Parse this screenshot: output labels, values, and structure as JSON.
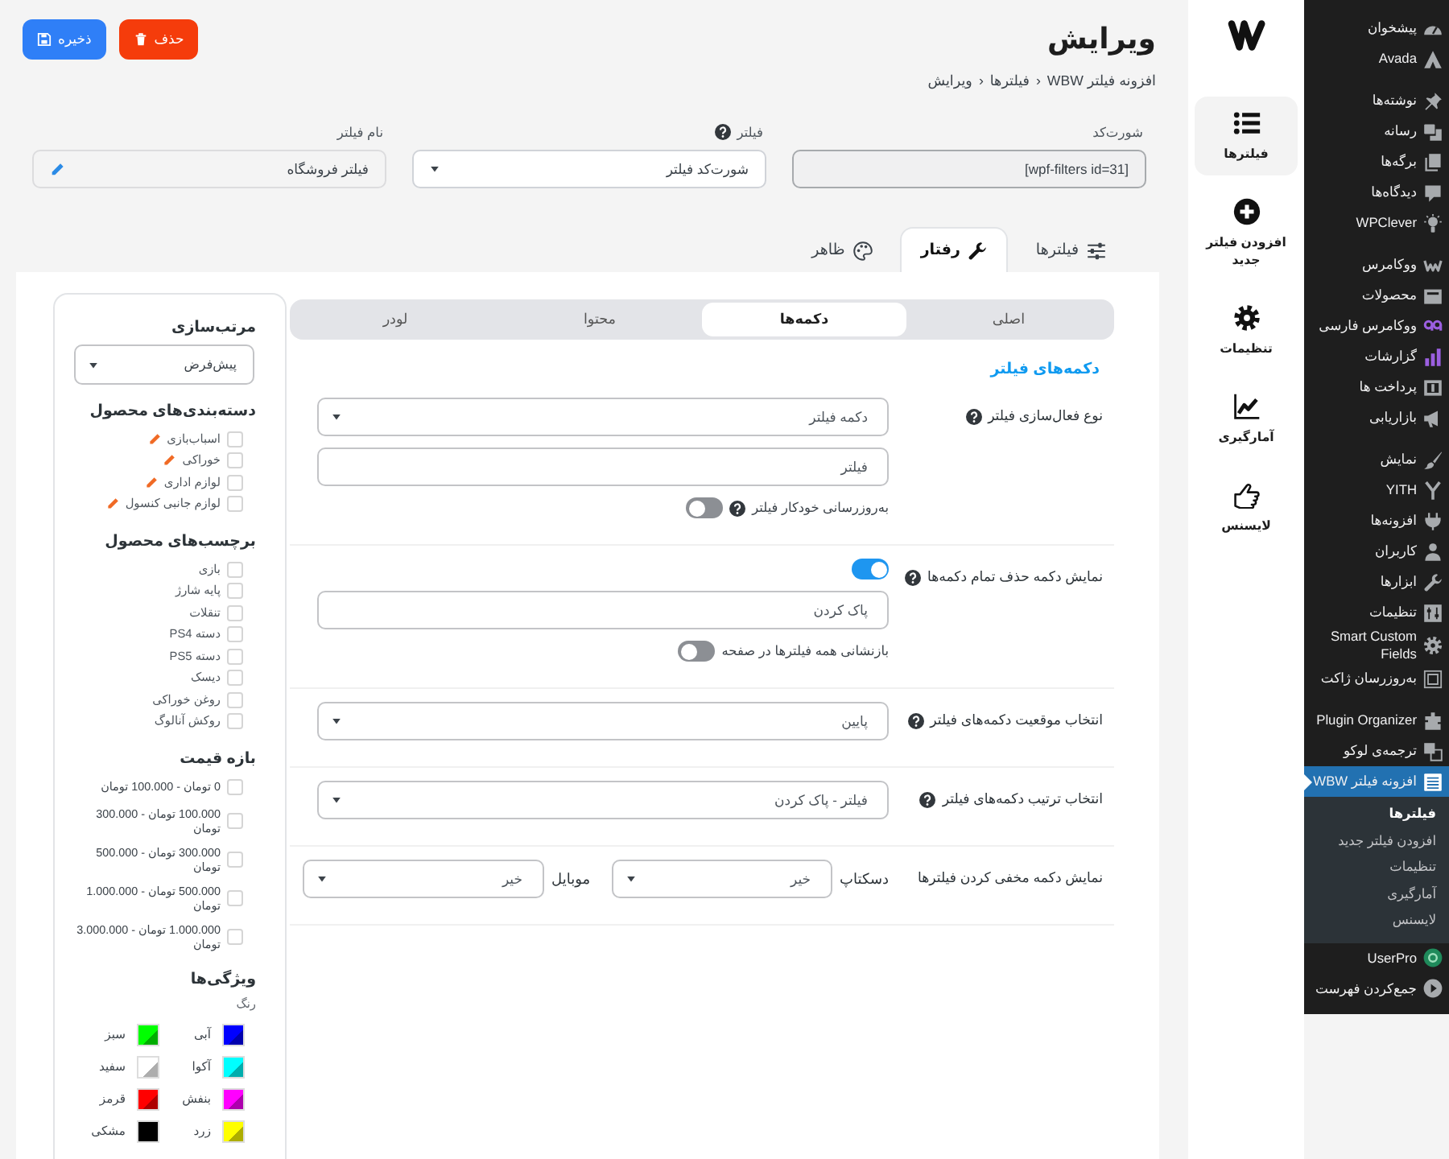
{
  "admin_menu": {
    "groups": [
      {
        "items": [
          {
            "label": "پیشخوان",
            "selected": false
          },
          {
            "label": "Avada",
            "selected": false
          }
        ]
      },
      {
        "items": [
          {
            "label": "نوشته‌ها",
            "selected": false
          },
          {
            "label": "رسانه",
            "selected": false
          },
          {
            "label": "برگه‌ها",
            "selected": false
          },
          {
            "label": "دیدگاه‌ها",
            "selected": false
          },
          {
            "label": "WPClever",
            "selected": false
          }
        ]
      },
      {
        "items": [
          {
            "label": "ووکامرس",
            "selected": false
          },
          {
            "label": "محصولات",
            "selected": false
          },
          {
            "label": "ووکامرس فارسی",
            "selected": false
          },
          {
            "label": "گزارشات",
            "selected": false
          },
          {
            "label": "پرداخت ها",
            "selected": false
          },
          {
            "label": "بازاریابی",
            "selected": false
          }
        ]
      },
      {
        "items": [
          {
            "label": "نمایش",
            "selected": false
          },
          {
            "label": "YITH",
            "selected": false
          },
          {
            "label": "افزونه‌ها",
            "selected": false
          },
          {
            "label": "کاربران",
            "selected": false
          },
          {
            "label": "ابزارها",
            "selected": false
          },
          {
            "label": "تنظیمات",
            "selected": false
          },
          {
            "label": "Smart Custom Fields",
            "selected": false
          },
          {
            "label": "به‌روزرسان ژاکت",
            "selected": false
          }
        ]
      },
      {
        "items": [
          {
            "label": "Plugin Organizer",
            "selected": false
          },
          {
            "label": "ترجمه‌ی لوکو",
            "selected": false
          },
          {
            "label": "افزونه فیلتر WBW",
            "selected": true,
            "submenu": [
              {
                "label": "فیلترها",
                "selected": true
              },
              {
                "label": "افزودن فیلتر جدید",
                "selected": false
              },
              {
                "label": "تنظیمات",
                "selected": false
              },
              {
                "label": "آمارگیری",
                "selected": false
              },
              {
                "label": "لایسنس",
                "selected": false
              }
            ]
          },
          {
            "label": "UserPro",
            "selected": false
          },
          {
            "label": "جمع‌کردن فهرست",
            "selected": false
          }
        ]
      }
    ]
  },
  "plugin_nav": {
    "items": [
      {
        "label": "فیلترها",
        "selected": true
      },
      {
        "label": "افزودن فیلتر جدید",
        "selected": false
      },
      {
        "label": "تنظیمات",
        "selected": false
      },
      {
        "label": "آمارگیری",
        "selected": false
      },
      {
        "label": "لایسنس",
        "selected": false
      }
    ]
  },
  "header": {
    "title": "ویرایش",
    "breadcrumb": [
      {
        "kind": "link",
        "text": "افزونه فیلتر WBW"
      },
      {
        "kind": "separator",
        "text": "›"
      },
      {
        "kind": "link",
        "text": "فیلترها"
      },
      {
        "kind": "separator",
        "text": "›"
      },
      {
        "kind": "current",
        "text": "ویرایش"
      }
    ],
    "buttons": [
      {
        "kind": "delete",
        "label": "حذف"
      },
      {
        "kind": "save",
        "label": "ذخیره"
      }
    ]
  },
  "fields": [
    {
      "kind": "readonly",
      "label": "شورت‌کد",
      "help": false,
      "value": "[wpf-filters id=31]"
    },
    {
      "kind": "select",
      "label": "فیلتر",
      "help": true,
      "value": "شورت‌کد فیلتر"
    },
    {
      "kind": "editable",
      "label": "نام فیلتر",
      "help": false,
      "value": "فیلتر فروشگاه"
    }
  ],
  "tabs": [
    {
      "label": "فیلترها",
      "selected": false
    },
    {
      "label": "رفتار",
      "selected": true
    },
    {
      "label": "ظاهر",
      "selected": false
    }
  ],
  "subtabs": [
    {
      "label": "اصلی",
      "selected": false
    },
    {
      "label": "دکمه‌ها",
      "selected": true
    },
    {
      "label": "محتوا",
      "selected": false
    },
    {
      "label": "لودر",
      "selected": false
    }
  ],
  "section": {
    "title": "دکمه‌های فیلتر",
    "rows": [
      {
        "label": "نوع فعال‌سازی فیلتر",
        "help": true,
        "controls": [
          {
            "kind": "select",
            "value": "دکمه فیلتر"
          },
          {
            "kind": "input",
            "value": "فیلتر"
          },
          {
            "kind": "toggle",
            "label": "به‌روزرسانی خودکار فیلتر",
            "help": true,
            "on": false
          }
        ]
      },
      {
        "label": "نمایش دکمه حذف تمام دکمه‌ها",
        "help": true,
        "controls": [
          {
            "kind": "toggle",
            "on": true
          },
          {
            "kind": "input",
            "value": "پاک کردن"
          },
          {
            "kind": "toggle",
            "label": "بازنشانی همه فیلترها در صفحه",
            "on": false
          }
        ]
      },
      {
        "label": "انتخاب موقعیت دکمه‌های فیلتر",
        "help": true,
        "controls": [
          {
            "kind": "select",
            "value": "پایین"
          }
        ]
      },
      {
        "label": "انتخاب ترتیب دکمه‌های فیلتر",
        "help": true,
        "controls": [
          {
            "kind": "select",
            "value": "فیلتر - پاک کردن"
          }
        ]
      },
      {
        "label": "نمایش دکمه مخفی کردن فیلترها",
        "help": false,
        "controls": [
          {
            "kind": "pair",
            "items": [
              {
                "label": "دسکتاپ",
                "value": "خیر"
              },
              {
                "label": "موبایل",
                "value": "خیر"
              }
            ]
          }
        ]
      }
    ]
  },
  "preview": {
    "sort": {
      "title": "مرتب‌سازی",
      "value": "پیش‌فرض"
    },
    "categories": {
      "title": "دسته‌بندی‌های محصول",
      "items": [
        {
          "label": "اسباب‌بازی",
          "checked": false
        },
        {
          "label": "خوراکی",
          "checked": false
        },
        {
          "label": "لوازم اداری",
          "checked": false
        },
        {
          "label": "لوازم جانبی کنسول",
          "checked": false
        }
      ]
    },
    "tags": {
      "title": "برچسب‌های محصول",
      "items": [
        {
          "label": "بازی",
          "checked": false
        },
        {
          "label": "پایه شارژ",
          "checked": false
        },
        {
          "label": "تنقلات",
          "checked": false
        },
        {
          "label": "دسته PS4",
          "checked": false
        },
        {
          "label": "دسته PS5",
          "checked": false
        },
        {
          "label": "دیسک",
          "checked": false
        },
        {
          "label": "روغن خوراکی",
          "checked": false
        },
        {
          "label": "روکش آنالوگ",
          "checked": false
        }
      ]
    },
    "price": {
      "title": "بازه قیمت",
      "items": [
        {
          "label": "0 تومان - 100.000 تومان",
          "checked": false
        },
        {
          "label": "100.000 تومان - 300.000 تومان",
          "checked": false
        },
        {
          "label": "300.000 تومان - 500.000 تومان",
          "checked": false
        },
        {
          "label": "500.000 تومان - 1.000.000 تومان",
          "checked": false
        },
        {
          "label": "1.000.000 تومان - 3.000.000 تومان",
          "checked": false
        }
      ]
    },
    "attributes": {
      "title": "ویژگی‌ها",
      "subtitle": "رنگ",
      "colors": [
        {
          "label": "آبی",
          "color": "#0000ff"
        },
        {
          "label": "سبز",
          "color": "#00ff00"
        },
        {
          "label": "آکوا",
          "color": "#00ffff"
        },
        {
          "label": "سفید",
          "color": "#ffffff"
        },
        {
          "label": "بنفش",
          "color": "#ff00ff"
        },
        {
          "label": "قرمز",
          "color": "#ff0000"
        },
        {
          "label": "زرد",
          "color": "#ffff00"
        },
        {
          "label": "مشکی",
          "color": "#000000"
        }
      ]
    }
  }
}
